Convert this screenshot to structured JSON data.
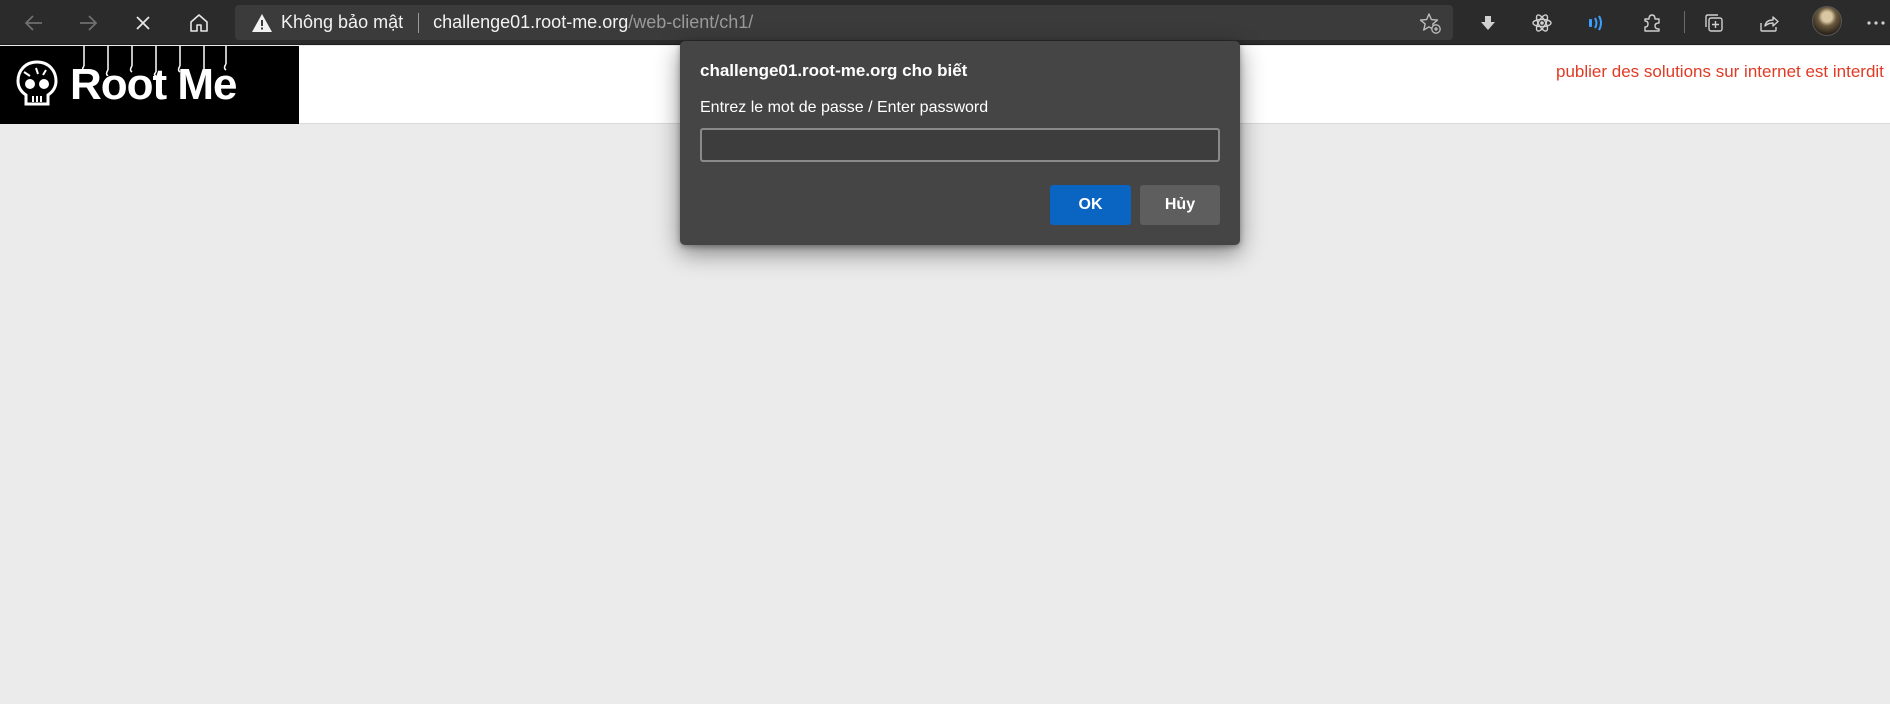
{
  "browser": {
    "security_label": "Không bảo mật",
    "url_host": "challenge01.root-me.org",
    "url_path": "/web-client/ch1/",
    "icons": {
      "back": "back-arrow-icon",
      "forward": "forward-arrow-icon",
      "stop": "close-icon",
      "home": "home-icon",
      "warning": "warning-icon",
      "favorite": "favorite-star-icon",
      "download": "download-icon",
      "react_devtools": "atom-icon",
      "read_aloud": "read-aloud-icon",
      "extensions": "puzzle-icon",
      "collections": "collections-icon",
      "share": "share-icon",
      "more": "more-icon"
    },
    "accent_color": "#3aa0ff"
  },
  "page": {
    "logo_text": "Root Me",
    "banner": "publier des solutions sur internet est interdit"
  },
  "dialog": {
    "title": "challenge01.root-me.org cho biết",
    "message": "Entrez le mot de passe / Enter password",
    "input_value": "",
    "ok_label": "OK",
    "cancel_label": "Hủy",
    "ok_color": "#0a64c2"
  }
}
